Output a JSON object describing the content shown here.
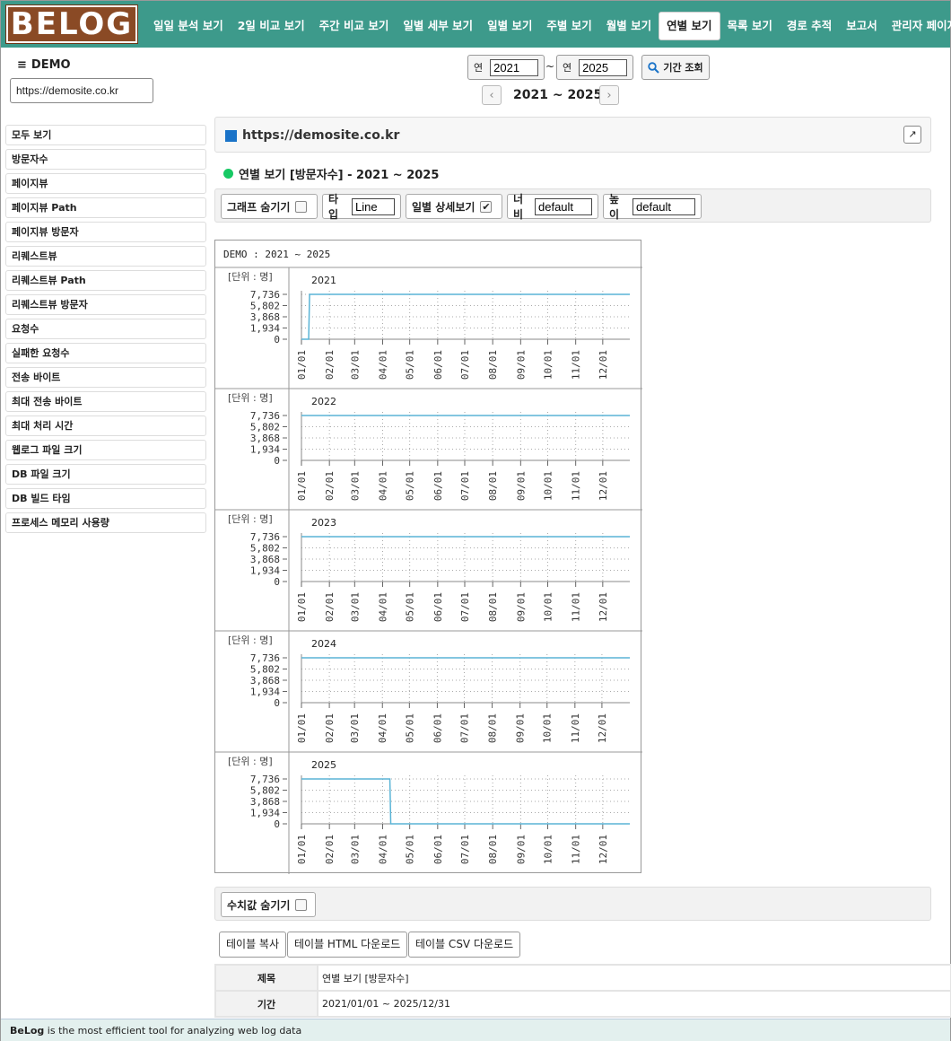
{
  "logo": {
    "text": "BELOG"
  },
  "nav": [
    {
      "label": "일일 분석 보기"
    },
    {
      "label": "2일 비교 보기"
    },
    {
      "label": "주간 비교 보기"
    },
    {
      "label": "일별 세부 보기"
    },
    {
      "label": "일별 보기"
    },
    {
      "label": "주별 보기"
    },
    {
      "label": "월별 보기"
    },
    {
      "label": "연별 보기",
      "active": true
    },
    {
      "label": "목록 보기"
    },
    {
      "label": "경로 추적"
    },
    {
      "label": "보고서"
    },
    {
      "label": "관리자 페이지"
    }
  ],
  "header": {
    "menu_icon": "≡",
    "site_name": "DEMO",
    "site_url": "https://demosite.co.kr",
    "year_label": "연",
    "from_year": "2021",
    "to_year": "2025",
    "tilde": "~",
    "query_label": "기간 조회",
    "period": "2021 ~ 2025",
    "prev_icon": "‹",
    "next_icon": "›"
  },
  "sidebar": {
    "items": [
      {
        "label": "모두 보기"
      },
      {
        "label": "방문자수"
      },
      {
        "label": "페이지뷰"
      },
      {
        "label": "페이지뷰 Path"
      },
      {
        "label": "페이지뷰 방문자"
      },
      {
        "label": "리퀘스트뷰"
      },
      {
        "label": "리퀘스트뷰 Path"
      },
      {
        "label": "리퀘스트뷰 방문자"
      },
      {
        "label": "요청수"
      },
      {
        "label": "실패한 요청수"
      },
      {
        "label": "전송 바이트"
      },
      {
        "label": "최대 전송 바이트"
      },
      {
        "label": "최대 처리 시간"
      },
      {
        "label": "웹로그 파일 크기"
      },
      {
        "label": "DB 파일 크기"
      },
      {
        "label": "DB 빌드 타임"
      },
      {
        "label": "프로세스 메모리 사용량"
      }
    ]
  },
  "main": {
    "site_url": "https://demosite.co.kr",
    "ext_icon": "↗",
    "section_title": "연별 보기 [방문자수] - 2021 ~ 2025",
    "options": {
      "hide_graph": "그래프 숨기기",
      "type_label": "타입",
      "type_value": "Line",
      "daily_detail": "일별 상세보기",
      "daily_checked": "✔",
      "width_label": "너비",
      "width_value": "default",
      "height_label": "높이",
      "height_value": "default"
    },
    "hide_values": "수치값 숨기기",
    "buttons": {
      "copy": "테이블 복사",
      "html": "테이블 HTML 다운로드",
      "csv": "테이블 CSV 다운로드"
    },
    "table": [
      {
        "key": "제목",
        "value": "연별 보기 [방문자수]"
      },
      {
        "key": "기간",
        "value": "2021/01/01 ~ 2025/12/31"
      }
    ]
  },
  "footer": {
    "brand": "BeLog",
    "text": " is the most efficient tool for analyzing web log data"
  },
  "chart_data": {
    "type": "line",
    "caption": "DEMO : 2021 ~ 2025",
    "unit_label": "[단위 : 명]",
    "yticks": [
      "7,736",
      "5,802",
      "3,868",
      "1,934",
      "0"
    ],
    "ylim": [
      0,
      7736
    ],
    "xticks": [
      "01/01",
      "02/01",
      "03/01",
      "04/01",
      "05/01",
      "06/01",
      "07/01",
      "08/01",
      "09/01",
      "10/01",
      "11/01",
      "12/01"
    ],
    "color": "#5ab4d6",
    "grid": true,
    "panels": [
      {
        "name": "2021",
        "segments": [
          {
            "from_day": 1,
            "to_day": 9,
            "value": 0
          },
          {
            "from_day": 10,
            "to_day": 365,
            "value": 7736
          }
        ]
      },
      {
        "name": "2022",
        "segments": [
          {
            "from_day": 1,
            "to_day": 365,
            "value": 7736
          }
        ]
      },
      {
        "name": "2023",
        "segments": [
          {
            "from_day": 1,
            "to_day": 365,
            "value": 7736
          }
        ]
      },
      {
        "name": "2024",
        "segments": [
          {
            "from_day": 1,
            "to_day": 366,
            "value": 7736
          }
        ]
      },
      {
        "name": "2025",
        "segments": [
          {
            "from_day": 1,
            "to_day": 99,
            "value": 7736
          },
          {
            "from_day": 100,
            "to_day": 365,
            "value": 0
          }
        ]
      }
    ]
  }
}
